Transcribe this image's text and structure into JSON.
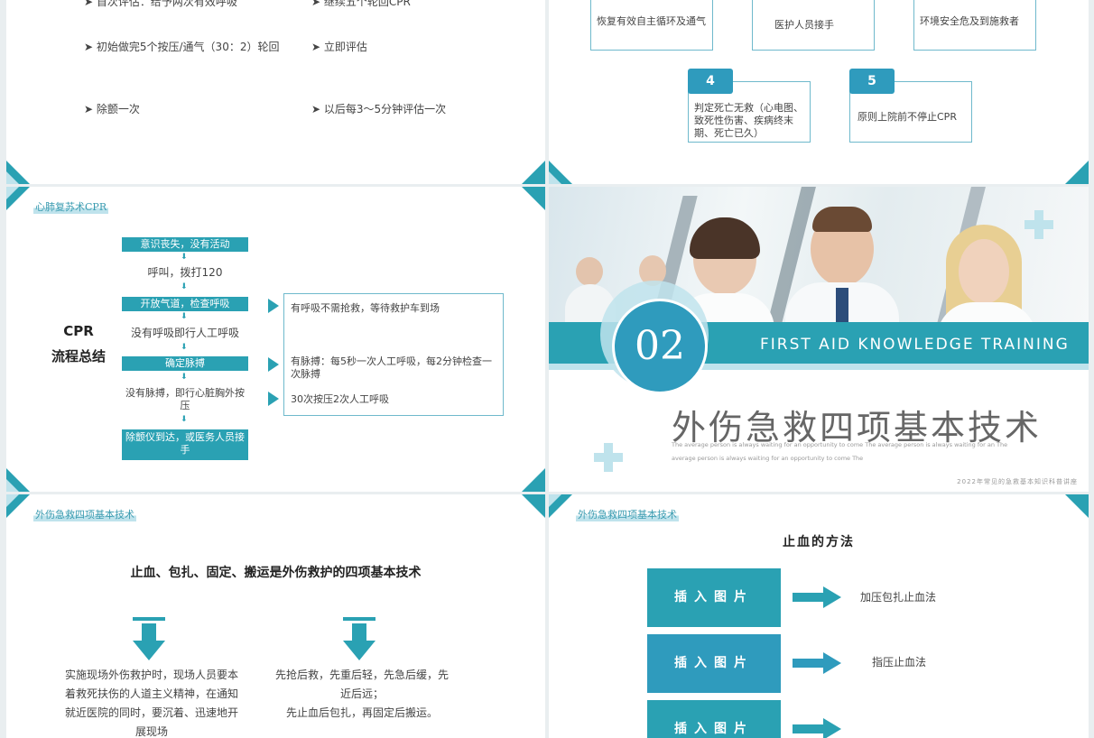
{
  "slide1": {
    "rows": [
      [
        "首次评估：给予两次有效呼吸",
        "继续五个轮回CPR"
      ],
      [
        "初始做完5个按压/通气（30：2）轮回",
        "立即评估"
      ],
      [
        "除颤一次",
        "以后每3～5分钟评估一次"
      ]
    ]
  },
  "slide2": {
    "top_boxes": [
      "恢复有效自主循环及通气",
      "医护人员接手",
      "环境安全危及到施救者"
    ],
    "items": [
      {
        "num": "4",
        "text": "判定死亡无救（心电图、致死性伤害、疾病终末期、死亡已久）"
      },
      {
        "num": "5",
        "text": "原则上院前不停止CPR"
      }
    ]
  },
  "slide3": {
    "header": "心肺复苏术CPR",
    "side_title_1": "CPR",
    "side_title_2": "流程总结",
    "steps": [
      "意识丧失，没有活动",
      "呼叫，拨打120",
      "开放气道，检查呼吸",
      "没有呼吸即行人工呼吸",
      "确定脉搏",
      "没有脉搏，即行心脏胸外按压",
      "除颤仪到达，或医务人员接手"
    ],
    "notes": [
      "有呼吸不需抢救，等待救护车到场",
      "有脉搏：每5秒一次人工呼吸，每2分钟检查一次脉搏",
      "30次按压2次人工呼吸"
    ]
  },
  "slide4": {
    "number": "02",
    "banner": "FIRST AID KNOWLEDGE TRAINING",
    "title": "外伤急救四项基本技术",
    "sub1": "The average person is always waiting for an opportunity to come The average person is always waiting for an The",
    "sub2": "average person is always waiting for an opportunity to come The",
    "footer": "2022年常见的急救基本知识科普讲座"
  },
  "slide5": {
    "header": "外伤急救四项基本技术",
    "heading": "止血、包扎、固定、搬运是外伤救护的四项基本技术",
    "left_text": "实施现场外伤救护时，现场人员要本着救死扶伤的人道主义精神，在通知就近医院的同时，要沉着、迅速地开展现场",
    "right_text_1": "先抢后救，先重后轻，先急后缓，先近后远；",
    "right_text_2": "先止血后包扎，再固定后搬运。"
  },
  "slide6": {
    "header": "外伤急救四项基本技术",
    "heading": "止血的方法",
    "buttons": [
      "插入图片",
      "插入图片",
      "插入图片"
    ],
    "methods": [
      "加压包扎止血法",
      "指压止血法"
    ]
  },
  "colors": {
    "teal": "#2aa1b3",
    "blue": "#2f9bbd",
    "light": "#bfe3ec"
  }
}
